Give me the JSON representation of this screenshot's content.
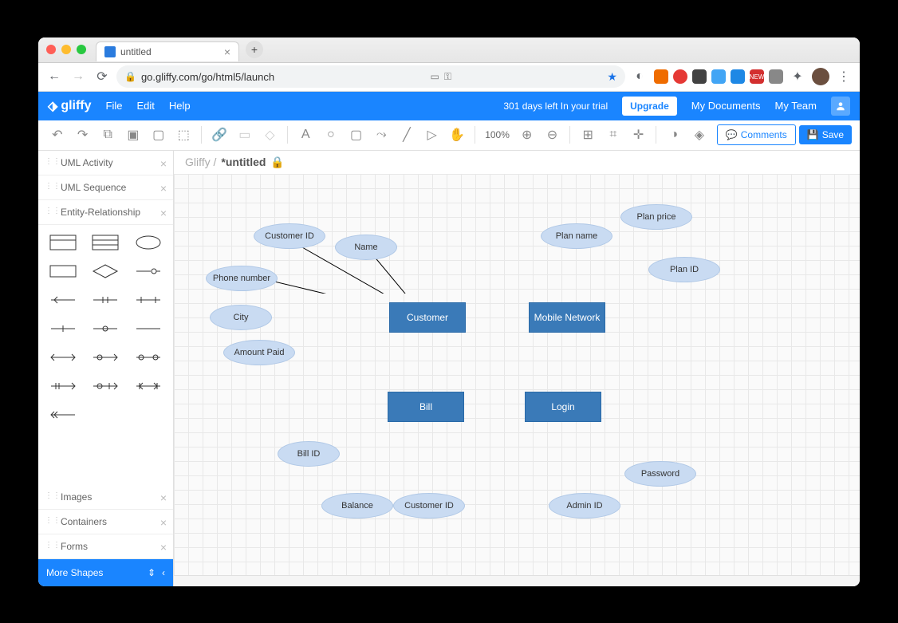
{
  "browser": {
    "tab_title": "untitled",
    "url": "go.gliffy.com/go/html5/launch"
  },
  "menu": {
    "logo": "gliffy",
    "file": "File",
    "edit": "Edit",
    "help": "Help",
    "trial": "301 days left In your trial",
    "upgrade": "Upgrade",
    "docs": "My Documents",
    "team": "My Team"
  },
  "toolbar": {
    "zoom": "100% ",
    "comments": "Comments",
    "save": "Save"
  },
  "sidebar": {
    "sections": {
      "uml_activity": "UML Activity",
      "uml_sequence": "UML Sequence",
      "er": "Entity-Relationship",
      "images": "Images",
      "containers": "Containers",
      "forms": "Forms"
    },
    "more": "More Shapes"
  },
  "breadcrumb": {
    "root": "Gliffy /",
    "doc": "*untitled"
  },
  "diagram": {
    "entities": {
      "customer": "Customer",
      "mobile_network": "Mobile Network",
      "bill": "Bill",
      "login": "Login"
    },
    "attrs": {
      "customer_id": "Customer ID",
      "name": "Name",
      "phone": "Phone number",
      "city": "City",
      "amount_paid": "Amount Paid",
      "plan_name": "Plan name",
      "plan_price": "Plan price",
      "plan_id": "Plan ID",
      "bill_id": "Bill ID",
      "balance": "Balance",
      "customer_id2": "Customer ID",
      "admin_id": "Admin ID",
      "password": "Password"
    }
  }
}
